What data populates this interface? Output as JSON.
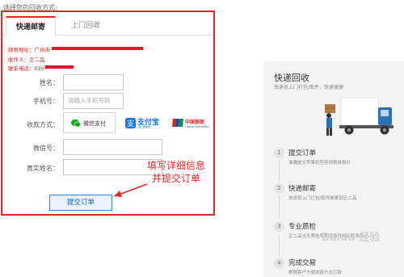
{
  "page": {
    "heading": "选择您的回收方式:"
  },
  "tabs": [
    {
      "label": "快递邮寄",
      "active": true
    },
    {
      "label": "上门回收",
      "active": false
    }
  ],
  "address": {
    "mail_address": "邮寄地址：广州市",
    "recipient": "收件人：正二品",
    "phone": "联系电话：020-"
  },
  "form": {
    "name_label": "姓名：",
    "phone_label": "手机号：",
    "phone_placeholder": "请输入手机号码",
    "payment_label": "收款方式：",
    "wechat_label": "微信支付",
    "alipay_label": "支付宝",
    "alipay_sub": "ALIPAY",
    "unionpay_label": "中国银联",
    "unionpay_sub": "China UnionPay",
    "wechat_id_label": "微信号：",
    "real_name_label": "真实姓名：",
    "submit_label": "提交订单"
  },
  "annotation": {
    "line1": "填写详细信息",
    "line2": "并提交订单"
  },
  "panel": {
    "title": "快递回收",
    "subtitle": "快递员上门打包/取件，快速便捷",
    "steps": [
      {
        "num": "1",
        "title": "提交订单",
        "desc": "准确提交苹果机型获得精准报价"
      },
      {
        "num": "2",
        "title": "快递邮寄",
        "desc": "快递员上门打包/取件邮寄到正二品"
      },
      {
        "num": "3",
        "title": "专业质检",
        "desc": "正二品当天质检苹果设备并电话联系客户"
      },
      {
        "num": "4",
        "title": "完成交易",
        "desc": "根据客户方便收款方式打款"
      }
    ]
  },
  "watermark": "Baidu 经验",
  "colors": {
    "accent_red": "#e8262a",
    "button_blue": "#3a84d8",
    "wechat_green": "#1aad19",
    "alipay_blue": "#1677ff",
    "unionpay_red": "#d0262b",
    "truck_blue": "#2e6fb3"
  }
}
